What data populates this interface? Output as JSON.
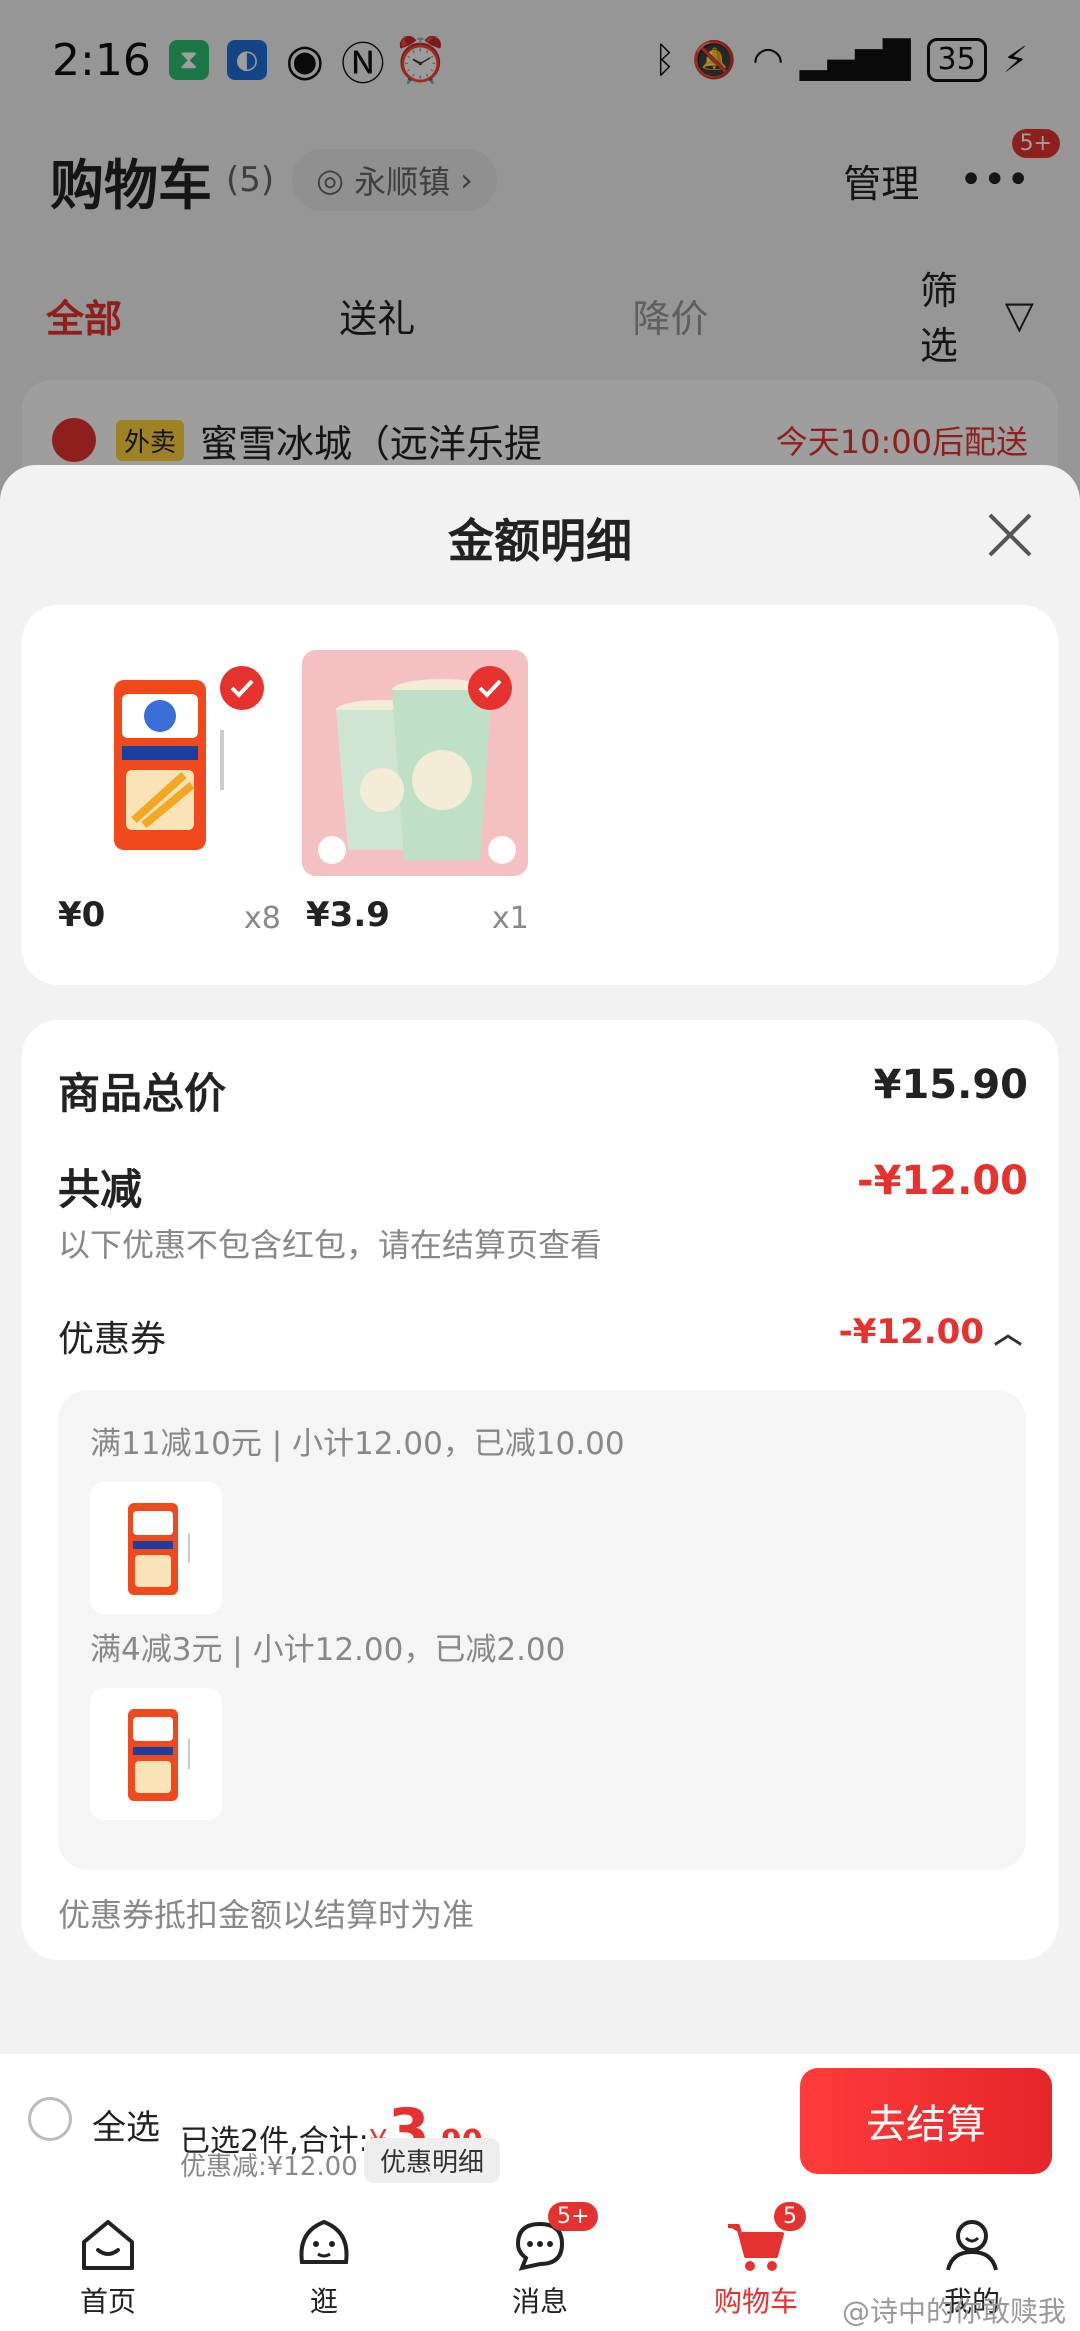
{
  "status_bar": {
    "time": "2:16",
    "battery": "35"
  },
  "header": {
    "title": "购物车",
    "count": "(5)",
    "location": "永顺镇",
    "manage": "管理",
    "more_badge": "5+"
  },
  "filter_tabs": [
    "全部",
    "送礼",
    "降价",
    "筛选"
  ],
  "store": {
    "tag": "外卖",
    "name": "蜜雪冰城（远洋乐提",
    "delivery": "今天10:00后配送"
  },
  "sheet": {
    "title": "金额明细",
    "products": [
      {
        "price_int": "¥0",
        "price_dec": "",
        "qty": "x8",
        "image": "snack-pack"
      },
      {
        "price_int": "¥3",
        "price_dec": ".9",
        "qty": "x1",
        "image": "drink-cups"
      }
    ],
    "summary": {
      "total_label": "商品总价",
      "total_value": "¥15.90",
      "reduce_label": "共减",
      "reduce_value": "-¥12.00",
      "reduce_note": "以下优惠不包含红包，请在结算页查看",
      "coupon_label": "优惠券",
      "coupon_value": "-¥12.00",
      "rules": [
        {
          "text": "满11减10元 | 小计12.00，已减10.00"
        },
        {
          "text": "满4减3元 | 小计12.00，已减2.00"
        }
      ],
      "footnote": "优惠券抵扣金额以结算时为准"
    }
  },
  "checkout": {
    "select_all": "全选",
    "selected_prefix": "已选2件,合计:",
    "yen": "¥",
    "total_int": "3",
    "total_dec": ".90",
    "discount": "优惠减:¥12.00",
    "detail_pill": "优惠明细",
    "button": "去结算"
  },
  "nav": [
    {
      "label": "首页",
      "icon": "home-icon",
      "badge": ""
    },
    {
      "label": "逛",
      "icon": "browse-icon",
      "badge": ""
    },
    {
      "label": "消息",
      "icon": "message-icon",
      "badge": "5+"
    },
    {
      "label": "购物车",
      "icon": "cart-icon",
      "badge": "5"
    },
    {
      "label": "我的",
      "icon": "profile-icon",
      "badge": ""
    }
  ],
  "watermark": "@诗中的你敢赎我",
  "colors": {
    "accent": "#e6322e",
    "background": "#f2f2f2"
  }
}
